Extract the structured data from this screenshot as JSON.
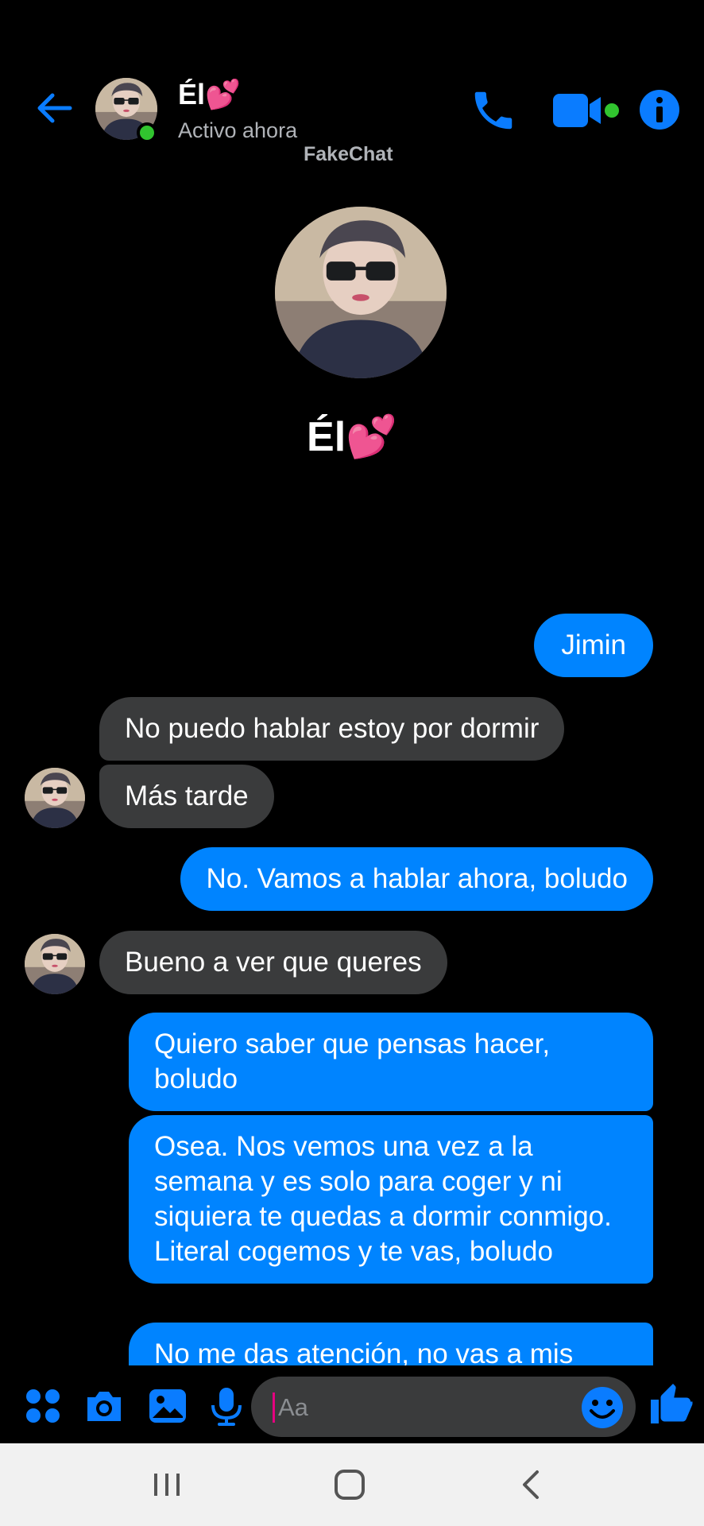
{
  "header": {
    "name": "Él💕",
    "status": "Activo ahora",
    "watermark": "FakeChat"
  },
  "profile": {
    "name": "Él💕"
  },
  "messages": [
    {
      "side": "out",
      "text": "Jimin"
    },
    {
      "side": "in",
      "text": "No puedo hablar estoy por dormir"
    },
    {
      "side": "in",
      "text": "Más tarde"
    },
    {
      "side": "out",
      "text": "No. Vamos a hablar ahora, boludo"
    },
    {
      "side": "in",
      "text": "Bueno a ver que queres"
    },
    {
      "side": "out",
      "text": "Quiero saber que pensas hacer, boludo"
    },
    {
      "side": "out",
      "text": "Osea. Nos vemos una vez a la semana y es solo para coger y ni siquiera te quedas a dormir conmigo. Literal cogemos y te vas, boludo"
    },
    {
      "side": "out",
      "text": "No me das atención, no vas a mis"
    }
  ],
  "composer": {
    "placeholder": "Aa"
  },
  "colors": {
    "accent": "#0084ff",
    "incoming_bubble": "#3a3b3c",
    "online": "#31c42f",
    "background": "#000000"
  },
  "icons": {
    "back": "arrow-left-icon",
    "call": "phone-icon",
    "video": "video-camera-icon",
    "info": "info-icon",
    "grid": "apps-grid-icon",
    "camera": "camera-icon",
    "image": "image-icon",
    "mic": "microphone-icon",
    "emoji": "smiley-icon",
    "like": "thumbs-up-icon"
  }
}
